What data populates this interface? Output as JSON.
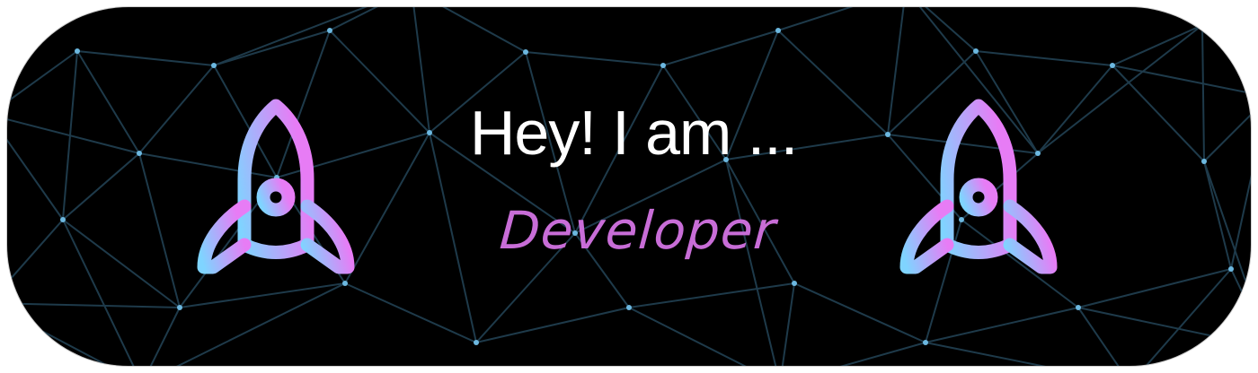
{
  "banner": {
    "headline": "Hey! I am ...",
    "role": "Developer"
  },
  "icons": {
    "left": "rocket-icon",
    "right": "rocket-icon"
  },
  "colors": {
    "background": "#000000",
    "network_line": "#1e3a4a",
    "network_node": "#6cb8e0",
    "headline": "#ffffff",
    "role": "#c86dd7",
    "rocket_gradient_start": "#7fd4ff",
    "rocket_gradient_end": "#e77cf5"
  }
}
